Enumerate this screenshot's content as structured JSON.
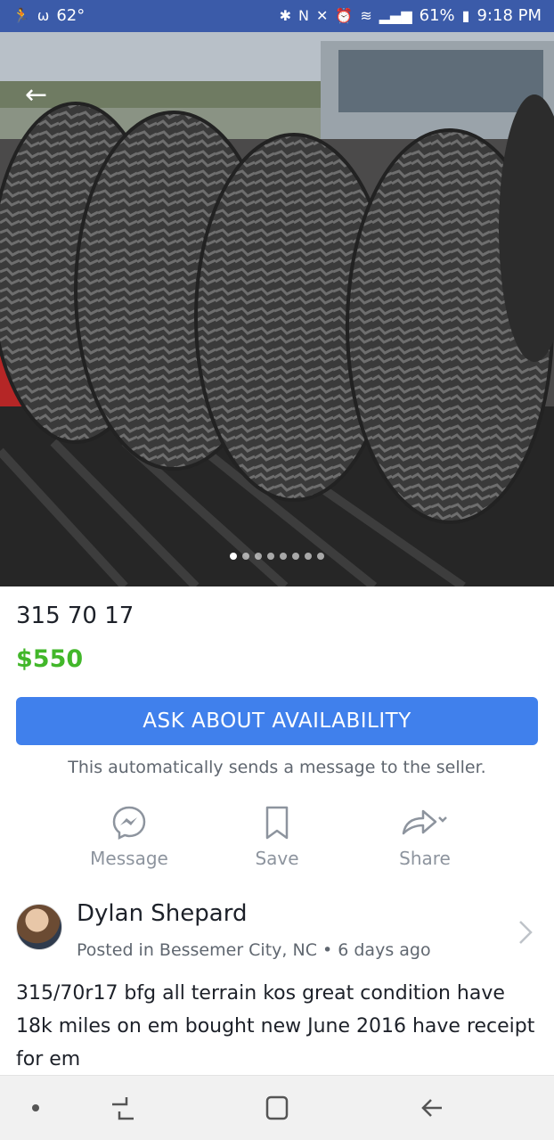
{
  "status_bar": {
    "temperature": "62°",
    "battery": "61%",
    "time": "9:18 PM"
  },
  "photo": {
    "carousel_count": 8,
    "carousel_active_index": 0
  },
  "listing": {
    "title": "315 70 17",
    "price": "$550"
  },
  "ask": {
    "button_label": "ASK ABOUT AVAILABILITY",
    "note": "This automatically sends a message to the seller."
  },
  "actions": {
    "message_label": "Message",
    "save_label": "Save",
    "share_label": "Share"
  },
  "seller": {
    "name": "Dylan Shepard",
    "posted": "Posted in Bessemer City, NC • 6 days ago"
  },
  "description": "315/70r17 bfg all terrain kos great condition have 18k miles on em bought new June 2016 have receipt for em",
  "colors": {
    "status_bar": "#3b5ba9",
    "primary_button": "#4080ec",
    "price": "#42b72a",
    "secondary_text": "#606770",
    "action_gray": "#8d949e"
  }
}
